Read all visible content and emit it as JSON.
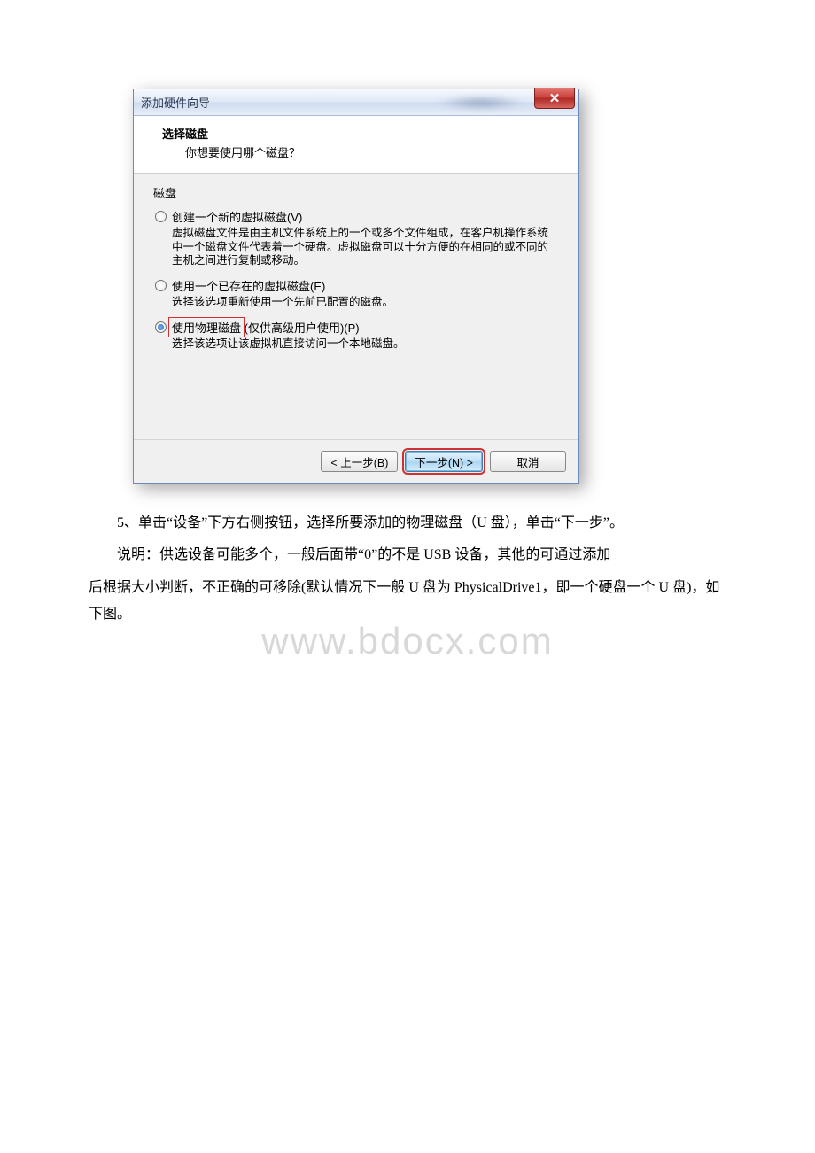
{
  "dialog": {
    "title": "添加硬件向导",
    "close_glyph": "✕",
    "header": {
      "title": "选择磁盘",
      "subtitle": "你想要使用哪个磁盘？"
    },
    "group_label": "磁盘",
    "options": [
      {
        "label": "创建一个新的虚拟磁盘(V)",
        "help": "虚拟磁盘文件是由主机文件系统上的一个或多个文件组成，在客户机操作系统中一个磁盘文件代表着一个硬盘。虚拟磁盘可以十分方便的在相同的或不同的主机之间进行复制或移动。",
        "selected": false
      },
      {
        "label": "使用一个已存在的虚拟磁盘(E)",
        "help": "选择该选项重新使用一个先前已配置的磁盘。",
        "selected": false
      },
      {
        "label_prefix": "使用物理磁盘",
        "label_suffix": "(仅供高级用户使用)(P)",
        "help": "选择该选项让该虚拟机直接访问一个本地磁盘。",
        "selected": true
      }
    ],
    "buttons": {
      "back": "< 上一步(B)",
      "next": "下一步(N) >",
      "cancel": "取消"
    }
  },
  "paragraphs": {
    "p1": "5、单击“设备”下方右侧按钮，选择所要添加的物理磁盘（U 盘），单击“下一步”。",
    "p2": "说明：供选设备可能多个，一般后面带“0”的不是 USB 设备，其他的可通过添加",
    "p3": "后根据大小判断，不正确的可移除(默认情况下一般 U 盘为 PhysicalDrive1，即一个硬盘一个 U 盘)，如下图。"
  },
  "watermark": "www.bdocx.com"
}
